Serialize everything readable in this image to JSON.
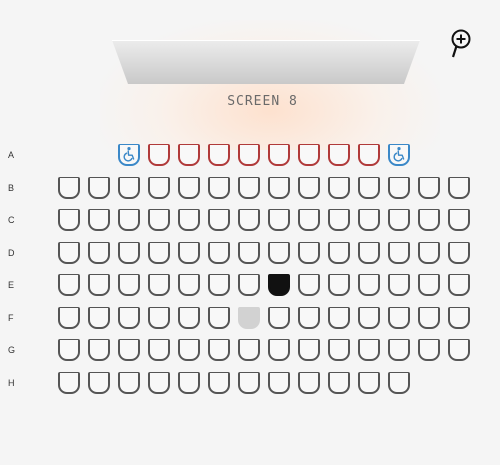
{
  "screen": {
    "label": "SCREEN 8"
  },
  "zoom": {
    "icon": "zoom-in-icon"
  },
  "colors": {
    "standard": "#555555",
    "premium": "#b03a3a",
    "wheelchair": "#3a88c8",
    "selected": "#111111",
    "unavailable": "#d2d2d2"
  },
  "rows": [
    {
      "label": "A",
      "start": 2,
      "seats": [
        "wheelchair",
        "premium",
        "premium",
        "premium",
        "premium",
        "premium",
        "premium",
        "premium",
        "premium",
        "wheelchair"
      ]
    },
    {
      "label": "B",
      "start": 0,
      "seats": [
        "standard",
        "standard",
        "standard",
        "standard",
        "standard",
        "standard",
        "standard",
        "standard",
        "standard",
        "standard",
        "standard",
        "standard",
        "standard",
        "standard"
      ]
    },
    {
      "label": "C",
      "start": 0,
      "seats": [
        "standard",
        "standard",
        "standard",
        "standard",
        "standard",
        "standard",
        "standard",
        "standard",
        "standard",
        "standard",
        "standard",
        "standard",
        "standard",
        "standard"
      ]
    },
    {
      "label": "D",
      "start": 0,
      "seats": [
        "standard",
        "standard",
        "standard",
        "standard",
        "standard",
        "standard",
        "standard",
        "standard",
        "standard",
        "standard",
        "standard",
        "standard",
        "standard",
        "standard"
      ]
    },
    {
      "label": "E",
      "start": 0,
      "seats": [
        "standard",
        "standard",
        "standard",
        "standard",
        "standard",
        "standard",
        "standard",
        "selected",
        "standard",
        "standard",
        "standard",
        "standard",
        "standard",
        "standard"
      ]
    },
    {
      "label": "F",
      "start": 0,
      "seats": [
        "standard",
        "standard",
        "standard",
        "standard",
        "standard",
        "standard",
        "unavailable",
        "standard",
        "standard",
        "standard",
        "standard",
        "standard",
        "standard",
        "standard"
      ]
    },
    {
      "label": "G",
      "start": 0,
      "seats": [
        "standard",
        "standard",
        "standard",
        "standard",
        "standard",
        "standard",
        "standard",
        "standard",
        "standard",
        "standard",
        "standard",
        "standard",
        "standard",
        "standard"
      ]
    },
    {
      "label": "H",
      "start": 0,
      "seats": [
        "standard",
        "standard",
        "standard",
        "standard",
        "standard",
        "standard",
        "standard",
        "standard",
        "standard",
        "standard",
        "standard",
        "standard"
      ]
    }
  ]
}
